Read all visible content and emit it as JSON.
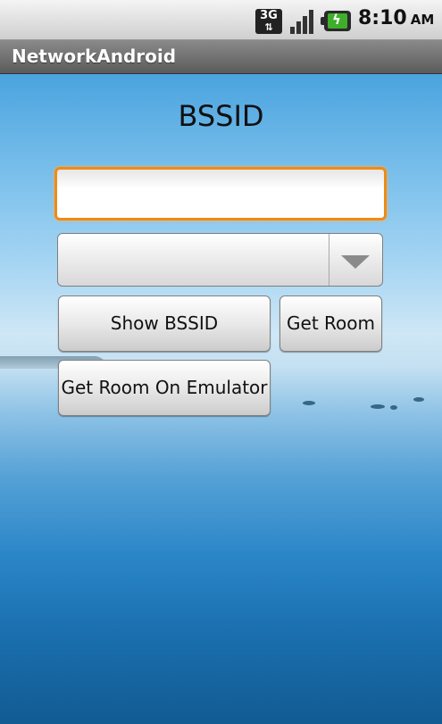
{
  "status_bar": {
    "network_label": "3G",
    "network_icon": "3g-data-icon",
    "signal_icon": "signal-strength-icon",
    "battery_icon": "battery-charging-icon",
    "time": "8:10",
    "ampm": "AM"
  },
  "app": {
    "title": "NetworkAndroid"
  },
  "main": {
    "heading": "BSSID",
    "input_value": "",
    "spinner_selected": "",
    "buttons": {
      "show_bssid": "Show BSSID",
      "get_room": "Get Room",
      "get_room_emulator": "Get Room On Emulator"
    }
  },
  "colors": {
    "focus_border": "#f08a16",
    "sky_top": "#4aa4df",
    "water_bottom": "#125b93"
  }
}
